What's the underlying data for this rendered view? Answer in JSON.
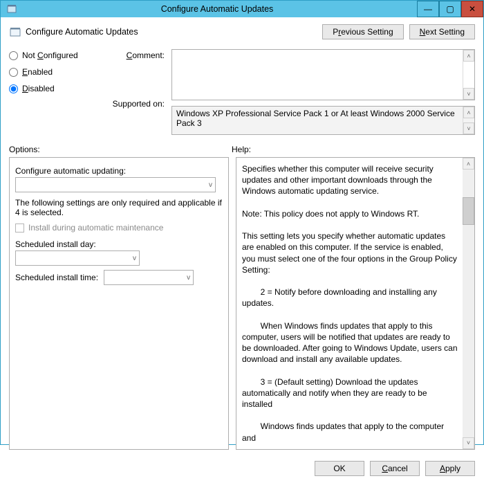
{
  "window": {
    "title": "Configure Automatic Updates"
  },
  "header": {
    "policy_title": "Configure Automatic Updates",
    "prev_pre": "P",
    "prev_u": "r",
    "prev_post": "evious Setting",
    "next_pre": "",
    "next_u": "N",
    "next_post": "ext Setting"
  },
  "state": {
    "not_configured_pre": "Not ",
    "not_configured_u": "C",
    "not_configured_post": "onfigured",
    "enabled_u": "E",
    "enabled_post": "nabled",
    "disabled_u": "D",
    "disabled_post": "isabled",
    "selected": "disabled",
    "comment_label_u": "C",
    "comment_label_post": "omment:",
    "supported_label": "Supported on:",
    "supported_text": "Windows XP Professional Service Pack 1 or At least Windows 2000 Service Pack 3"
  },
  "panes": {
    "options_label": "Options:",
    "help_label": "Help:"
  },
  "options": {
    "cau_label": "Configure automatic updating:",
    "note": "The following settings are only required and applicable if 4 is selected.",
    "install_maint": "Install during automatic maintenance",
    "sched_day_label": "Scheduled install day:",
    "sched_time_label": "Scheduled install time:"
  },
  "help": {
    "p1": "Specifies whether this computer will receive security updates and other important downloads through the Windows automatic updating service.",
    "p2": "Note: This policy does not apply to Windows RT.",
    "p3": "This setting lets you specify whether automatic updates are enabled on this computer. If the service is enabled, you must select one of the four options in the Group Policy Setting:",
    "p4": "        2 = Notify before downloading and installing any updates.",
    "p5": "        When Windows finds updates that apply to this computer, users will be notified that updates are ready to be downloaded. After going to Windows Update, users can download and install any available updates.",
    "p6": "        3 = (Default setting) Download the updates automatically and notify when they are ready to be installed",
    "p7": "        Windows finds updates that apply to the computer and"
  },
  "footer": {
    "ok": "OK",
    "cancel_u": "C",
    "cancel_post": "ancel",
    "apply_u": "A",
    "apply_post": "pply"
  },
  "glyphs": {
    "chev_up": "˄",
    "chev_down": "˅",
    "chev_dd": "v",
    "min": "—",
    "max": "▢",
    "close": "✕"
  }
}
